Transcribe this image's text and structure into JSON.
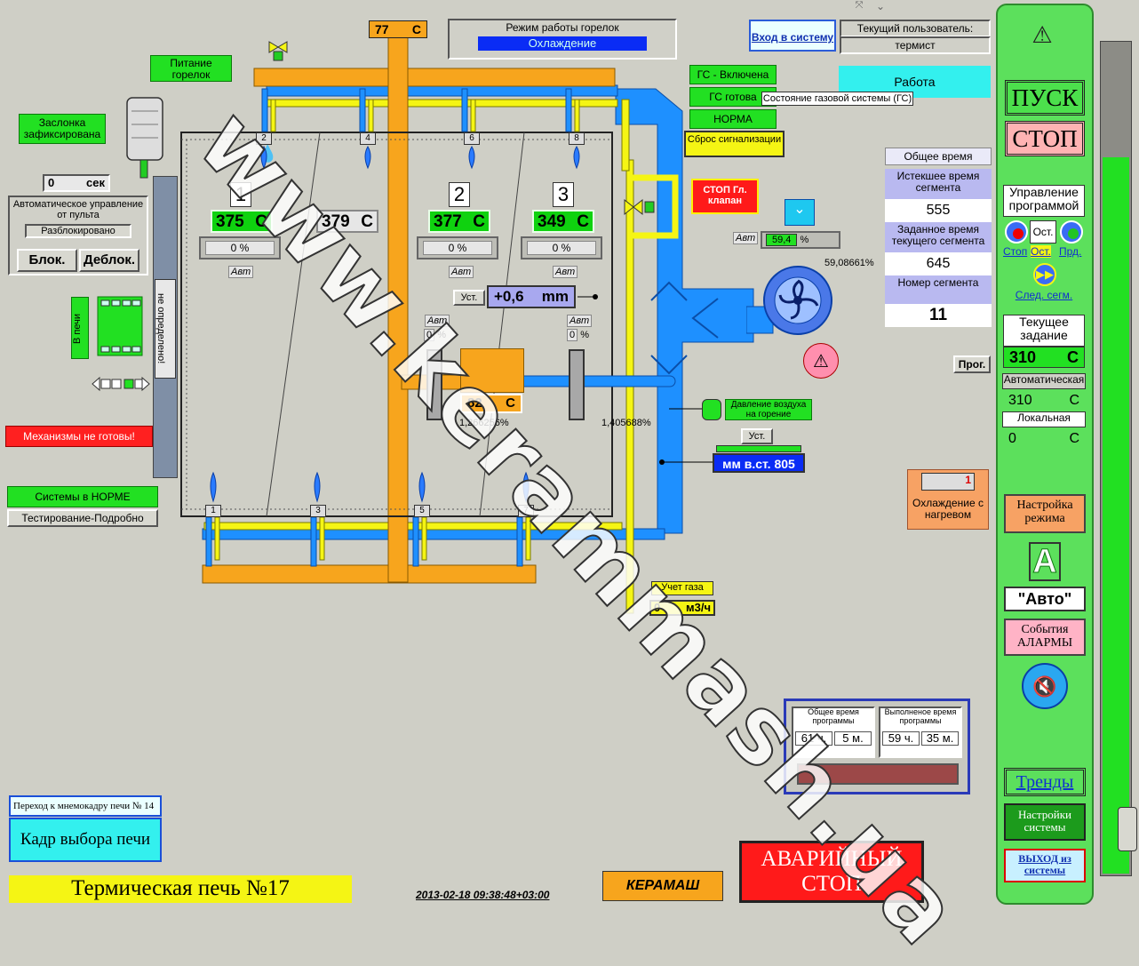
{
  "topbar": {
    "corner_icons": [
      "expand-icon",
      "chevron-down-icon"
    ]
  },
  "burner_mode": {
    "title": "Режим работы горелок",
    "value": "Охлаждение"
  },
  "login": {
    "button": "Вход в систему",
    "user_label": "Текущий пользователь:",
    "user": "термист"
  },
  "status": {
    "work": "Работа"
  },
  "gas": {
    "on": "ГС - Включена",
    "ready": "ГС готова",
    "tooltip": "Состояние газовой системы (ГС)",
    "norm": "НОРМА",
    "reset": "Сброс сигнализации",
    "stop_valve": "СТОП Гл. клапан"
  },
  "left": {
    "burner_power": "Питание горелок",
    "damper": "Заслонка зафиксирована",
    "seconds_value": "0",
    "seconds_unit": "сек",
    "auto_ctrl": "Автоматическое управление от пульта",
    "unlocked": "Разблокировано",
    "block": "Блок.",
    "unblock": "Деблок.",
    "in_furnace": "В печи",
    "undefined": "не определено!",
    "mechanisms": "Механизмы не готовы!",
    "systems_norm": "Системы в НОРМЕ",
    "testing": "Тестирование-Подробно",
    "goto_small": "Переход к мнемокадру печи № 14",
    "select_frame": "Кадр выбора печи",
    "title": "Термическая печь №17",
    "datetime": "2013-02-18 09:38:48+03:00"
  },
  "furnace": {
    "flue_temp": "77",
    "flue_unit": "С",
    "zones": [
      {
        "num": "1",
        "temp": "375",
        "unit": "С",
        "pct": "0",
        "mode": "Авт"
      },
      {
        "num": "",
        "temp": "379",
        "unit": "С",
        "pct": "",
        "mode": ""
      },
      {
        "num": "2",
        "temp": "377",
        "unit": "С",
        "pct": "0",
        "mode": "Авт"
      },
      {
        "num": "3",
        "temp": "349",
        "unit": "С",
        "pct": "0",
        "mode": "Авт"
      }
    ],
    "pct_sign": "%",
    "pressure_set": "Уст.",
    "pressure_value": "+0,6",
    "pressure_unit": "mm",
    "valve1": {
      "mode": "Авт",
      "pct": "0",
      "value": "1,266256%"
    },
    "valve2": {
      "mode": "Авт",
      "pct": "0",
      "value": "1,405688%"
    },
    "center_temp": "82",
    "center_unit": "С",
    "burners_top": [
      "2",
      "4",
      "6",
      "8"
    ],
    "burners_bottom": [
      "1",
      "3",
      "5",
      "7"
    ]
  },
  "fan": {
    "mode": "Авт",
    "pct": "59,4",
    "pct_sign": "%",
    "value": "59,08661%"
  },
  "air_pressure": {
    "label": "Давление воздуха на горение",
    "set": "Уст.",
    "value": "мм в.ст. 805"
  },
  "gas_meter": {
    "label": "Учет газа",
    "value": "0",
    "unit": "м3/ч"
  },
  "program": {
    "total_time": "Общее время",
    "elapsed_label": "Истекшее время сегмента",
    "elapsed": "555",
    "target_label": "Заданное время текущего сегмента",
    "target": "645",
    "segment_label": "Номер сегмента",
    "segment": "11"
  },
  "cooling": "Охлаждение с нагревом",
  "time_panel": {
    "total_label": "Общее время программы",
    "done_label": "Выполненое время программы",
    "total_h": "61 ч.",
    "total_m": "5 м.",
    "done_h": "59 ч.",
    "done_m": "35 м."
  },
  "emergency": "АВАРИЙНЫЙ СТОП",
  "logo": "КЕРАМАШ",
  "right": {
    "start": "ПУСК",
    "stop": "СТОП",
    "prog_ctrl": "Управление программой",
    "ctrl_stop": "Стоп",
    "ctrl_ost": "Ост.",
    "ctrl_prd": "Прд.",
    "ost_center": "Ост.",
    "next_seg": "След. сегм.",
    "current_task": "Текущее задание",
    "task_value": "310",
    "task_unit": "С",
    "prog_btn": "Прог.",
    "automatic": "Автоматическая",
    "auto_value": "310",
    "auto_unit": "С",
    "local": "Локальная",
    "local_value": "0",
    "local_unit": "С",
    "mode_settings": "Настройка режима",
    "mode_letter": "A",
    "mode_auto": "\"Авто\"",
    "events": "События АЛАРМЫ",
    "trends": "Тренды",
    "sys_settings": "Настройки системы",
    "exit": "ВЫХОД из системы"
  },
  "watermark": "www.kerammash.ua",
  "colors": {
    "orange": "#f7a51d",
    "blue": "#1e90ff",
    "yellow": "#f5f514",
    "green": "#22e022",
    "panel_green": "#5ce05c"
  }
}
